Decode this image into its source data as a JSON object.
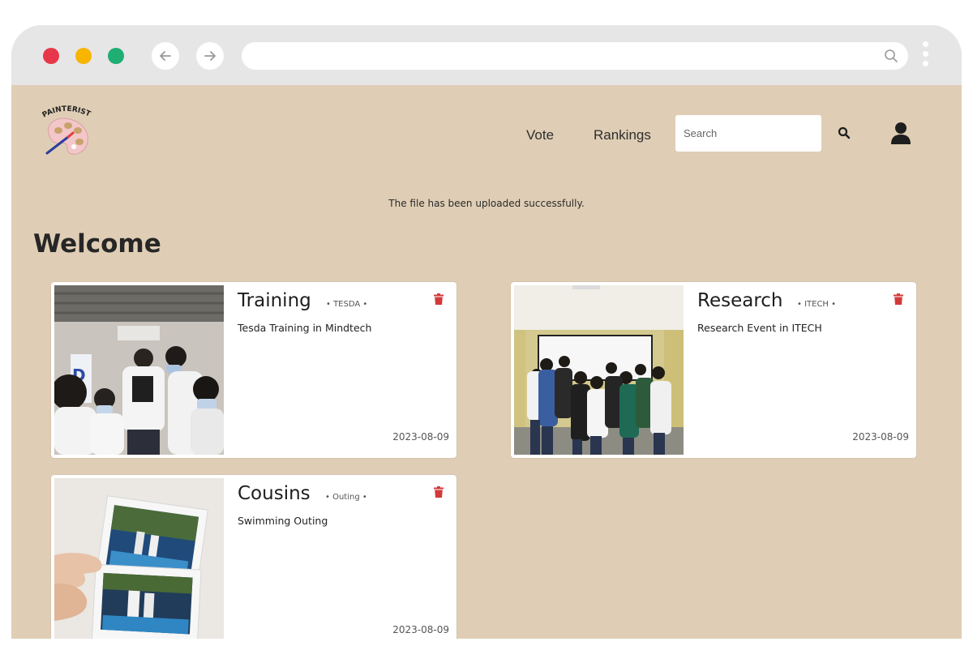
{
  "brand": {
    "logo_text": "PAINTERIST"
  },
  "nav": {
    "vote": "Vote",
    "rankings": "Rankings"
  },
  "search": {
    "placeholder": "Search"
  },
  "flash_message": "The file has been uploaded successfully.",
  "heading": "Welcome",
  "colors": {
    "page_bg": "#dfceb5",
    "delete_icon": "#d23a3a"
  },
  "posts": [
    {
      "title": "Training",
      "category": "• TESDA •",
      "description": "Tesda Training in Mindtech",
      "date": "2023-08-09"
    },
    {
      "title": "Research",
      "category": "• ITECH •",
      "description": "Research Event in ITECH",
      "date": "2023-08-09"
    },
    {
      "title": "Cousins",
      "category": "• Outing •",
      "description": "Swimming Outing",
      "date": "2023-08-09"
    }
  ]
}
